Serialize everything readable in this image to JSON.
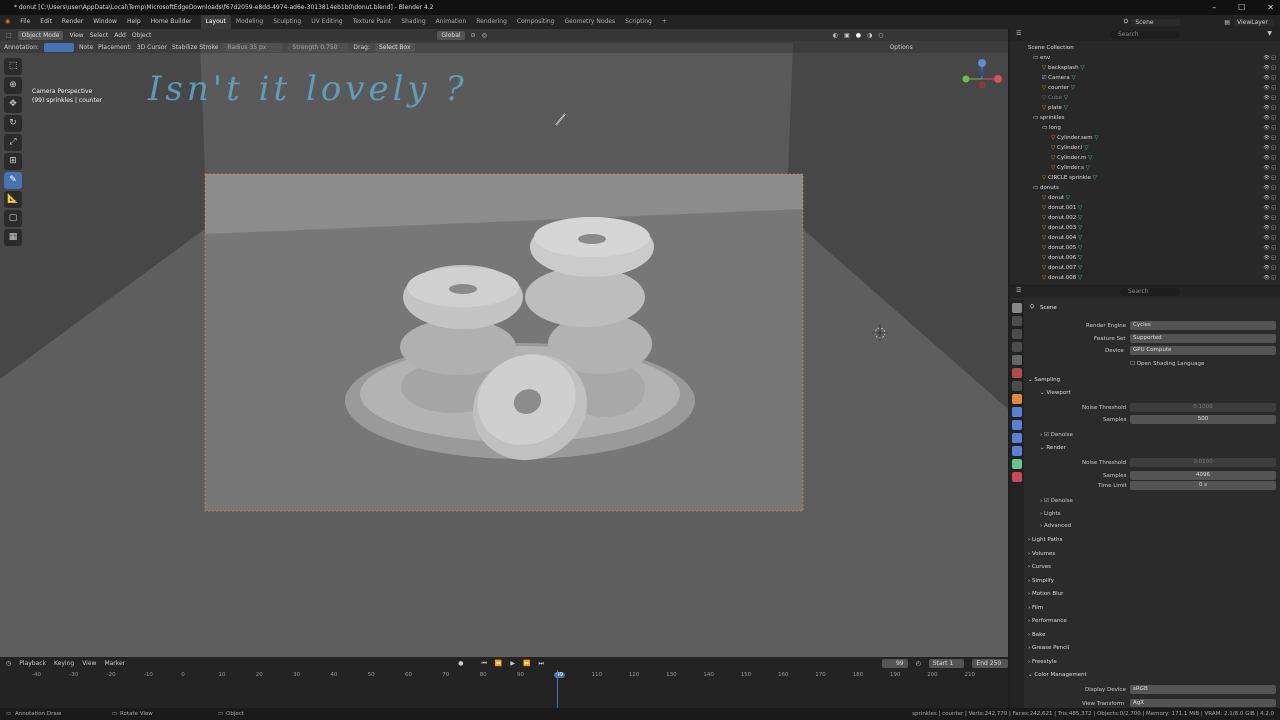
{
  "title": "* donut [C:\\Users\\user\\AppData\\Local\\Temp\\MicrosoftEdgeDownloads\\f67d2059-e8dd-4974-ad6e-3013814eb1b0\\donut.blend] - Blender 4.2",
  "menu": [
    "File",
    "Edit",
    "Render",
    "Window",
    "Help",
    "Home Builder"
  ],
  "workspaces": [
    "Layout",
    "Modeling",
    "Sculpting",
    "UV Editing",
    "Texture Paint",
    "Shading",
    "Animation",
    "Rendering",
    "Compositing",
    "Geometry Nodes",
    "Scripting"
  ],
  "top_right": {
    "scene": "Scene",
    "view_layer": "ViewLayer"
  },
  "viewport_header": {
    "mode": "Object Mode",
    "menus": [
      "View",
      "Select",
      "Add",
      "Object"
    ],
    "orientation": "Global"
  },
  "tool_header": {
    "annotation_label": "Annotation:",
    "note": "Note",
    "placement_label": "Placement:",
    "placement": "3D Cursor",
    "stabilize": "Stabilize Stroke",
    "radius": "Radius",
    "radius_val": "35 px",
    "factor": "Strength",
    "factor_val": "0.750",
    "drag_label": "Drag:",
    "drag": "Select Box",
    "options": "Options"
  },
  "camera_label": {
    "line1": "Camera Perspective",
    "line2": "(99) sprinkles | counter"
  },
  "annotation_text": "Isn't it lovely ?",
  "outliner": {
    "search_placeholder": "Search",
    "root": "Scene Collection",
    "rows": [
      {
        "label": "env",
        "indent": 1,
        "kind": "collection"
      },
      {
        "label": "backsplash",
        "indent": 2,
        "kind": "object"
      },
      {
        "label": "Camera",
        "indent": 2,
        "kind": "camera"
      },
      {
        "label": "counter",
        "indent": 2,
        "kind": "object"
      },
      {
        "label": "Cube",
        "indent": 2,
        "kind": "object-dim"
      },
      {
        "label": "plate",
        "indent": 2,
        "kind": "object"
      },
      {
        "label": "sprinkles",
        "indent": 1,
        "kind": "collection"
      },
      {
        "label": "long",
        "indent": 2,
        "kind": "collection"
      },
      {
        "label": "Cylinder.sem",
        "indent": 3,
        "kind": "object"
      },
      {
        "label": "Cylinder.l",
        "indent": 3,
        "kind": "object"
      },
      {
        "label": "Cylinder.m",
        "indent": 3,
        "kind": "object"
      },
      {
        "label": "Cylinder.s",
        "indent": 3,
        "kind": "object"
      },
      {
        "label": "CIRCLE sprinkle",
        "indent": 2,
        "kind": "object"
      },
      {
        "label": "donuts",
        "indent": 1,
        "kind": "collection"
      },
      {
        "label": "donut",
        "indent": 2,
        "kind": "object"
      },
      {
        "label": "donut.001",
        "indent": 2,
        "kind": "object"
      },
      {
        "label": "donut.002",
        "indent": 2,
        "kind": "object"
      },
      {
        "label": "donut.003",
        "indent": 2,
        "kind": "object"
      },
      {
        "label": "donut.004",
        "indent": 2,
        "kind": "object"
      },
      {
        "label": "donut.005",
        "indent": 2,
        "kind": "object"
      },
      {
        "label": "donut.006",
        "indent": 2,
        "kind": "object"
      },
      {
        "label": "donut.007",
        "indent": 2,
        "kind": "object"
      },
      {
        "label": "donut.008",
        "indent": 2,
        "kind": "object"
      }
    ]
  },
  "properties": {
    "search_placeholder": "Search",
    "context": "Scene",
    "render_engine_label": "Render Engine",
    "render_engine": "Cycles",
    "feature_set_label": "Feature Set",
    "feature_set": "Supported",
    "device_label": "Device",
    "device": "GPU Compute",
    "osl": "Open Shading Language",
    "sampling": "Sampling",
    "viewport": "Viewport",
    "noise_threshold_label": "Noise Threshold",
    "vp_noise": "0.1000",
    "samples_label": "Samples",
    "vp_samples": "500",
    "denoise": "Denoise",
    "render": "Render",
    "r_noise": "0.0100",
    "r_samples": "4096",
    "time_limit_label": "Time Limit",
    "time_limit": "0 s",
    "lights": "Lights",
    "advanced": "Advanced",
    "panels": [
      "Light Paths",
      "Volumes",
      "Curves",
      "Simplify",
      "Motion Blur",
      "Film",
      "Performance",
      "Bake",
      "Grease Pencil",
      "Freestyle",
      "Color Management"
    ],
    "display_device_label": "Display Device",
    "display_device": "sRGB",
    "view_transform_label": "View Transform",
    "view_transform": "AgX"
  },
  "timeline": {
    "menus": [
      "Playback",
      "Keying",
      "View",
      "Marker"
    ],
    "current_frame": "99",
    "start_label": "Start",
    "start": "1",
    "end_label": "End",
    "end": "250",
    "ticks": [
      "-40",
      "-30",
      "-20",
      "-10",
      "0",
      "10",
      "20",
      "30",
      "40",
      "50",
      "60",
      "70",
      "80",
      "90",
      "99",
      "110",
      "120",
      "130",
      "140",
      "150",
      "160",
      "170",
      "180",
      "190",
      "200",
      "210"
    ]
  },
  "status": {
    "left1": "Annotation Draw",
    "left2": "Rotate View",
    "left3": "Object",
    "right": "sprinkles | counter | Verts:242,770 | Faces:242,621 | Tris:485,372 | Objects:0/2,700 | Memory: 171.1 MiB | VRAM: 2.1/8.0 GiB | 4.2.0"
  },
  "colors": {
    "accent": "#4772b3",
    "annotation": "#5fa8c8",
    "object_orange": "#e08a3c",
    "modifier_green": "#63c48c"
  }
}
